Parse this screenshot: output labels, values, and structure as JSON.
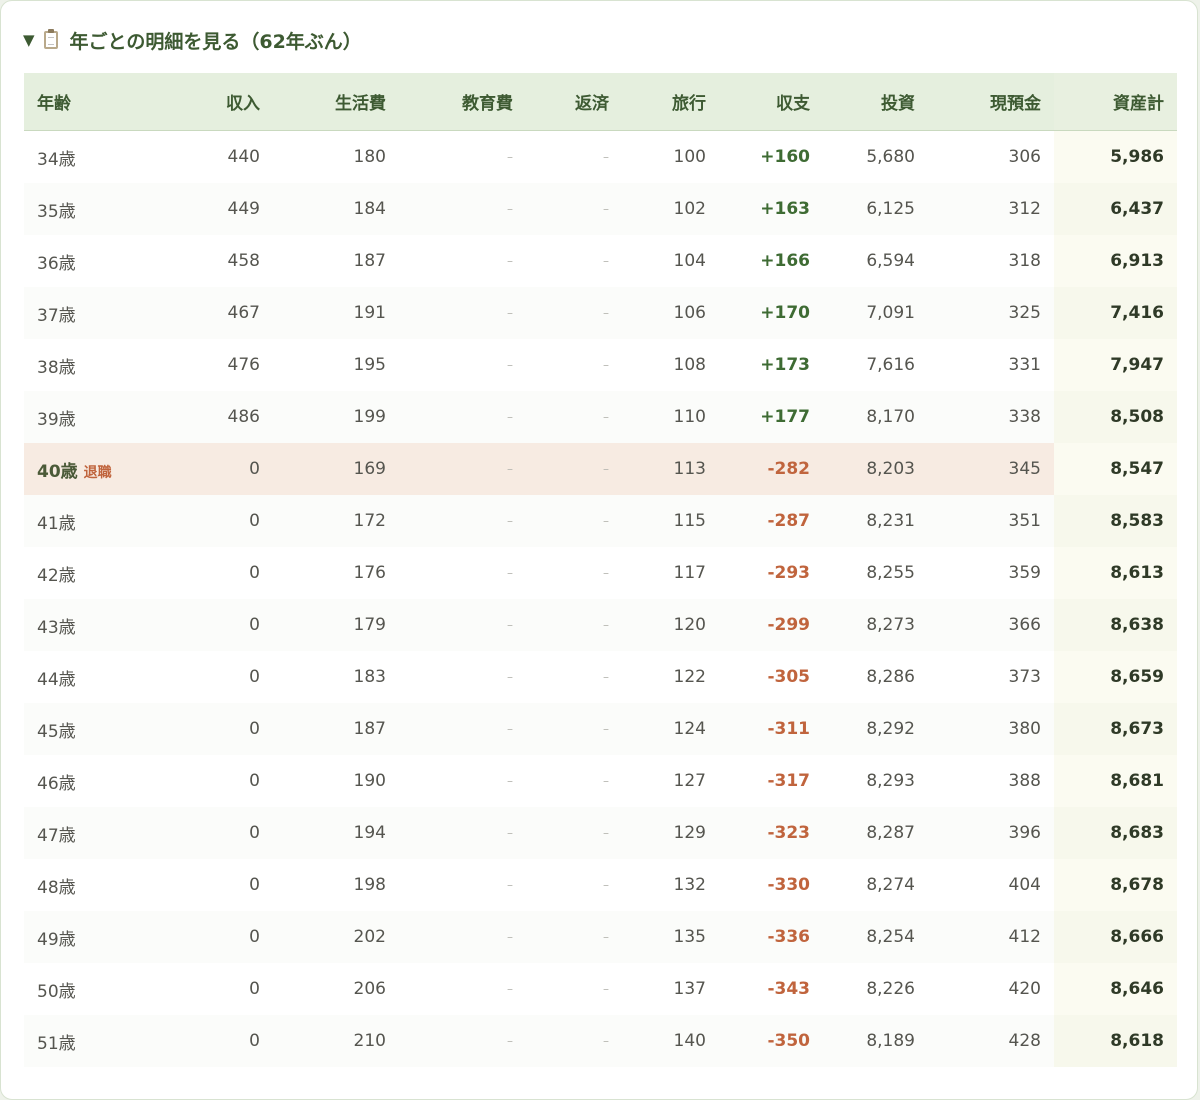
{
  "section": {
    "toggle_icon": "▼",
    "clipboard_icon": "clipboard-icon",
    "title": "年ごとの明細を見る（62年ぶん）"
  },
  "table": {
    "headers": [
      "年齢",
      "収入",
      "生活費",
      "教育費",
      "返済",
      "旅行",
      "収支",
      "投資",
      "現預金",
      "資産計"
    ],
    "retire_label": "退職",
    "rows": [
      {
        "age": "34歳",
        "income": "440",
        "living": "180",
        "education": "–",
        "repay": "–",
        "travel": "100",
        "balance": "+160",
        "invest": "5,680",
        "cash": "306",
        "total": "5,986"
      },
      {
        "age": "35歳",
        "income": "449",
        "living": "184",
        "education": "–",
        "repay": "–",
        "travel": "102",
        "balance": "+163",
        "invest": "6,125",
        "cash": "312",
        "total": "6,437"
      },
      {
        "age": "36歳",
        "income": "458",
        "living": "187",
        "education": "–",
        "repay": "–",
        "travel": "104",
        "balance": "+166",
        "invest": "6,594",
        "cash": "318",
        "total": "6,913"
      },
      {
        "age": "37歳",
        "income": "467",
        "living": "191",
        "education": "–",
        "repay": "–",
        "travel": "106",
        "balance": "+170",
        "invest": "7,091",
        "cash": "325",
        "total": "7,416"
      },
      {
        "age": "38歳",
        "income": "476",
        "living": "195",
        "education": "–",
        "repay": "–",
        "travel": "108",
        "balance": "+173",
        "invest": "7,616",
        "cash": "331",
        "total": "7,947"
      },
      {
        "age": "39歳",
        "income": "486",
        "living": "199",
        "education": "–",
        "repay": "–",
        "travel": "110",
        "balance": "+177",
        "invest": "8,170",
        "cash": "338",
        "total": "8,508"
      },
      {
        "age": "40歳",
        "income": "0",
        "living": "169",
        "education": "–",
        "repay": "–",
        "travel": "113",
        "balance": "-282",
        "invest": "8,203",
        "cash": "345",
        "total": "8,547"
      },
      {
        "age": "41歳",
        "income": "0",
        "living": "172",
        "education": "–",
        "repay": "–",
        "travel": "115",
        "balance": "-287",
        "invest": "8,231",
        "cash": "351",
        "total": "8,583"
      },
      {
        "age": "42歳",
        "income": "0",
        "living": "176",
        "education": "–",
        "repay": "–",
        "travel": "117",
        "balance": "-293",
        "invest": "8,255",
        "cash": "359",
        "total": "8,613"
      },
      {
        "age": "43歳",
        "income": "0",
        "living": "179",
        "education": "–",
        "repay": "–",
        "travel": "120",
        "balance": "-299",
        "invest": "8,273",
        "cash": "366",
        "total": "8,638"
      },
      {
        "age": "44歳",
        "income": "0",
        "living": "183",
        "education": "–",
        "repay": "–",
        "travel": "122",
        "balance": "-305",
        "invest": "8,286",
        "cash": "373",
        "total": "8,659"
      },
      {
        "age": "45歳",
        "income": "0",
        "living": "187",
        "education": "–",
        "repay": "–",
        "travel": "124",
        "balance": "-311",
        "invest": "8,292",
        "cash": "380",
        "total": "8,673"
      },
      {
        "age": "46歳",
        "income": "0",
        "living": "190",
        "education": "–",
        "repay": "–",
        "travel": "127",
        "balance": "-317",
        "invest": "8,293",
        "cash": "388",
        "total": "8,681"
      },
      {
        "age": "47歳",
        "income": "0",
        "living": "194",
        "education": "–",
        "repay": "–",
        "travel": "129",
        "balance": "-323",
        "invest": "8,287",
        "cash": "396",
        "total": "8,683"
      },
      {
        "age": "48歳",
        "income": "0",
        "living": "198",
        "education": "–",
        "repay": "–",
        "travel": "132",
        "balance": "-330",
        "invest": "8,274",
        "cash": "404",
        "total": "8,678"
      },
      {
        "age": "49歳",
        "income": "0",
        "living": "202",
        "education": "–",
        "repay": "–",
        "travel": "135",
        "balance": "-336",
        "invest": "8,254",
        "cash": "412",
        "total": "8,666"
      },
      {
        "age": "50歳",
        "income": "0",
        "living": "206",
        "education": "–",
        "repay": "–",
        "travel": "137",
        "balance": "-343",
        "invest": "8,226",
        "cash": "420",
        "total": "8,646"
      },
      {
        "age": "51歳",
        "income": "0",
        "living": "210",
        "education": "–",
        "repay": "–",
        "travel": "140",
        "balance": "-350",
        "invest": "8,189",
        "cash": "428",
        "total": "8,618"
      }
    ]
  },
  "colors": {
    "header_bg": "#e5efde",
    "accent_green": "#3d5a32",
    "positive": "#3e6b33",
    "negative": "#c0643d",
    "retire_row_bg": "#f7ebe2"
  }
}
